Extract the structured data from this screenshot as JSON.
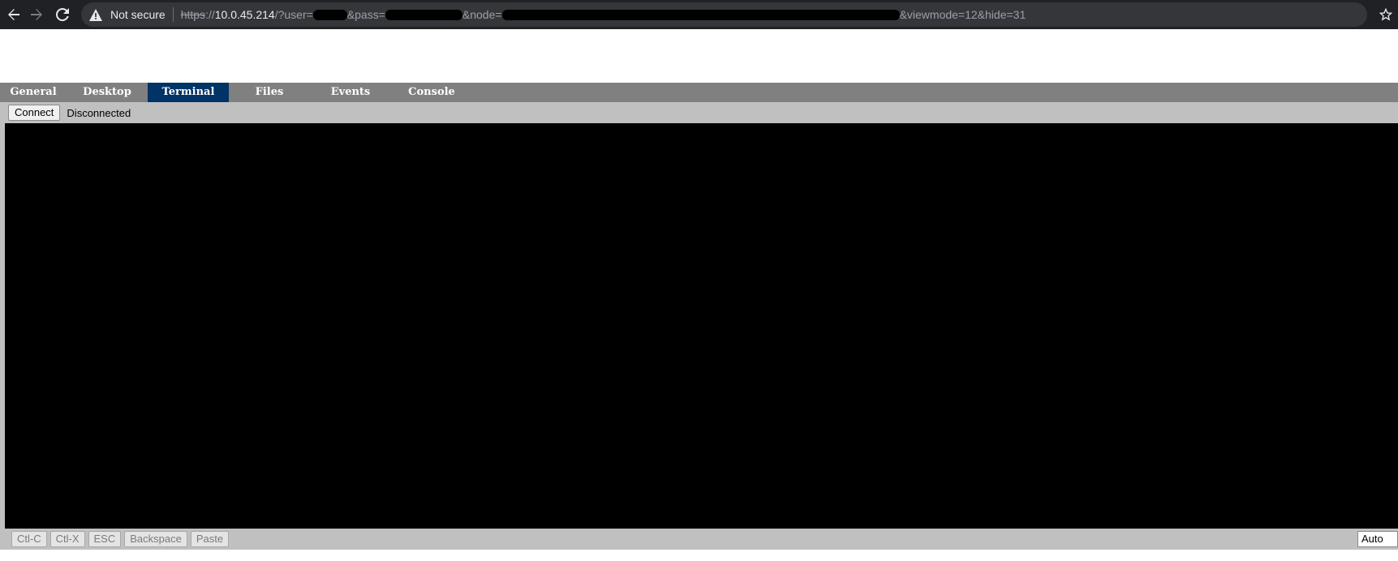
{
  "browser": {
    "security_label": "Not secure",
    "url": {
      "scheme": "https",
      "scheme_rest": "://",
      "host": "10.0.45.214",
      "part1": "/?user=",
      "part2": "&pass=",
      "part3": "&node=",
      "part4": "&viewmode=12&hide=31"
    }
  },
  "tabs": [
    {
      "label": "General"
    },
    {
      "label": "Desktop"
    },
    {
      "label": "Terminal",
      "active": true
    },
    {
      "label": "Files"
    },
    {
      "label": "Events"
    },
    {
      "label": "Console"
    }
  ],
  "toolbar": {
    "connect_label": "Connect",
    "status": "Disconnected"
  },
  "bottom": {
    "keys": [
      {
        "label": "Ctl-C"
      },
      {
        "label": "Ctl-X"
      },
      {
        "label": "ESC"
      },
      {
        "label": "Backspace"
      },
      {
        "label": "Paste"
      }
    ],
    "mode_value": "Auto"
  },
  "colors": {
    "tab_bar": "#808080",
    "tab_active": "#003366",
    "toolbar": "#c0c0c0",
    "terminal": "#000000"
  }
}
